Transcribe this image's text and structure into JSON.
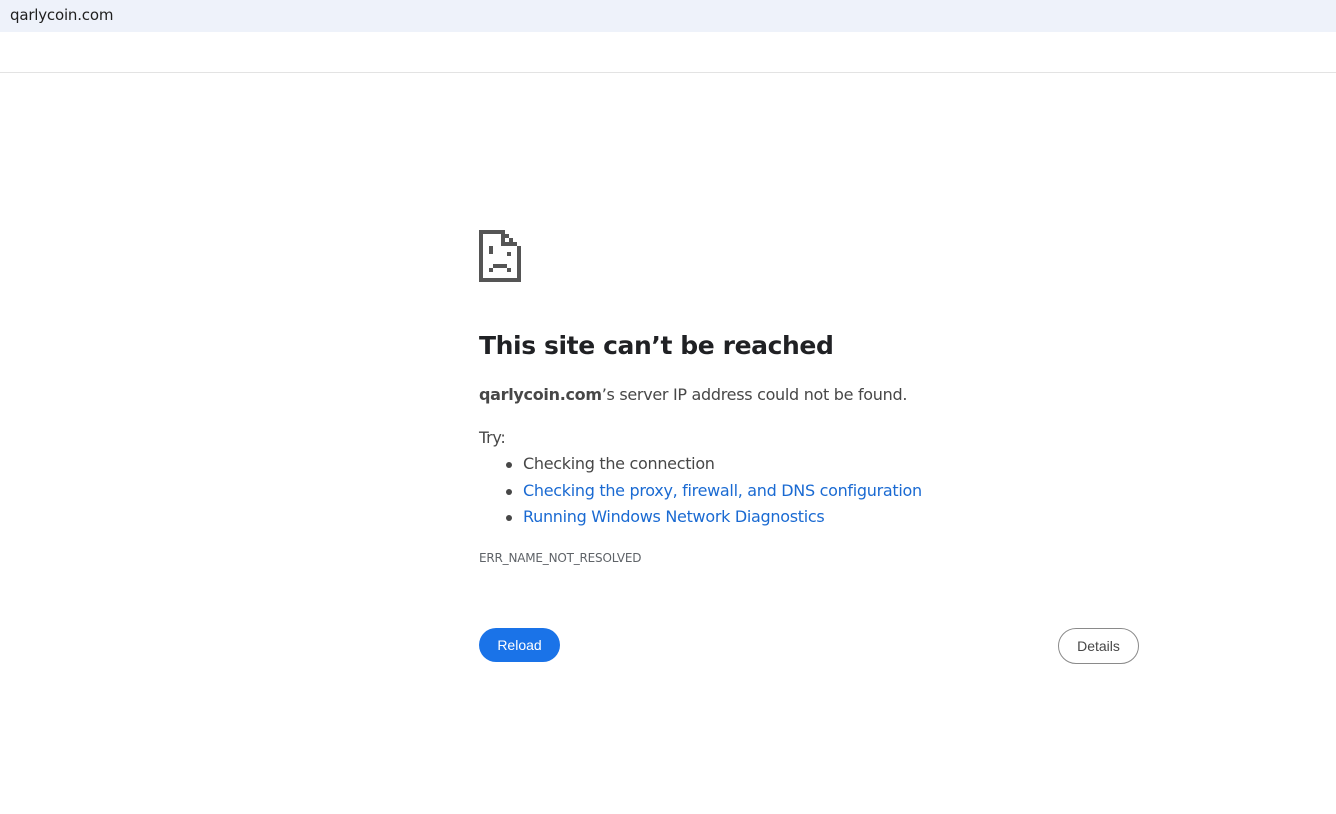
{
  "address_bar": {
    "url": "qarlycoin.com"
  },
  "error": {
    "icon": "sad-page-icon",
    "title": "This site can’t be reached",
    "domain": "qarlycoin.com",
    "summary_suffix": "’s server IP address could not be found.",
    "try_label": "Try:",
    "suggestions": [
      {
        "text": "Checking the connection",
        "is_link": false
      },
      {
        "text": "Checking the proxy, firewall, and DNS configuration",
        "is_link": true
      },
      {
        "text": "Running Windows Network Diagnostics",
        "is_link": true
      }
    ],
    "code": "ERR_NAME_NOT_RESOLVED"
  },
  "buttons": {
    "reload_label": "Reload",
    "details_label": "Details"
  },
  "colors": {
    "address_bar_bg": "#eef2fa",
    "link": "#1a6ad2",
    "primary_button": "#1a73e8",
    "body_text": "#474747",
    "title_text": "#202124"
  }
}
